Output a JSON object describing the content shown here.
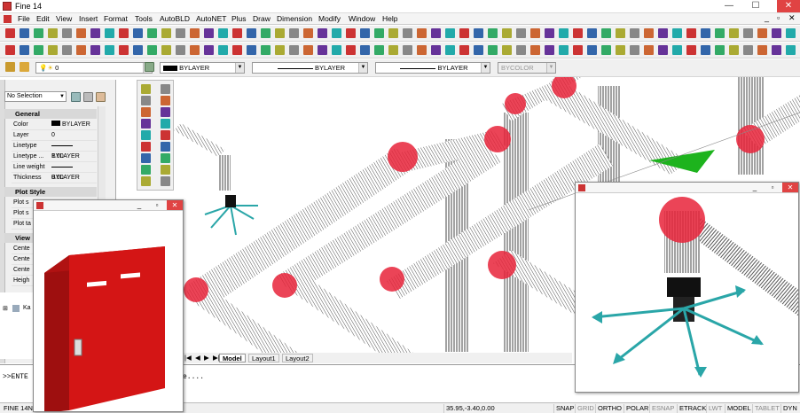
{
  "window": {
    "title": "Fine 14",
    "minimize": "—",
    "maximize": "☐",
    "close": "✕"
  },
  "menu": [
    "File",
    "Edit",
    "View",
    "Insert",
    "Format",
    "Tools",
    "AutoBLD",
    "AutoNET",
    "Plus",
    "Draw",
    "Dimension",
    "Modify",
    "Window",
    "Help"
  ],
  "inner_window_controls": {
    "minimize": "_",
    "maximize": "▫",
    "close": "✕"
  },
  "layer_bar": {
    "layer_value": "0",
    "color_value": "BYLAYER",
    "linetype_value": "BYLAYER",
    "lineweight_value": "BYLAYER",
    "plotstyle_value": "BYCOLOR"
  },
  "properties": {
    "selection": "No Selection",
    "general_title": "General",
    "rows": [
      {
        "k": "Color",
        "v": "BYLAYER"
      },
      {
        "k": "Layer",
        "v": "0"
      },
      {
        "k": "Linetype",
        "v": "BYLAYER"
      },
      {
        "k": "Linetype ...",
        "v": "1.00"
      },
      {
        "k": "Line weight",
        "v": "BYLAYER"
      },
      {
        "k": "Thickness",
        "v": "0.00"
      }
    ],
    "plot_title": "Plot Style",
    "plot_rows": [
      "Plot s",
      "Plot s",
      "Plot ta"
    ],
    "view_title": "View",
    "view_rows": [
      "Cente",
      "Cente",
      "Cente",
      "Heigh"
    ]
  },
  "tree": {
    "item": "Ka"
  },
  "tabs": {
    "model": "Model",
    "layout1": "Layout1",
    "layout2": "Layout2"
  },
  "command": {
    "prompt": ">>ENTE",
    "tail": "e...."
  },
  "status": {
    "left": "FINE 14N",
    "coords": "35.95,-3.40,0.00",
    "buttons": [
      "SNAP",
      "GRID",
      "ORTHO",
      "POLAR",
      "ESNAP",
      "ETRACK",
      "LWT",
      "MODEL",
      "TABLET",
      "DYN"
    ]
  },
  "colors": {
    "pipe_end": "#e8233a",
    "cabinet": "#d41515",
    "arrow": "#2aa6a8",
    "green_plane": "#1db31d"
  }
}
